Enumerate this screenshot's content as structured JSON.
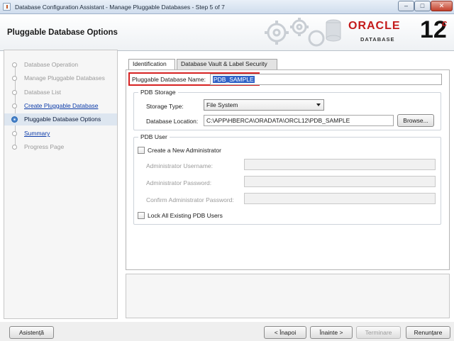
{
  "window": {
    "title": "Database Configuration Assistant - Manage Pluggable Databases - Step 5 of 7",
    "minimize_glyph": "‒",
    "maximize_glyph": "□",
    "close_glyph": "✕"
  },
  "header": {
    "page_title": "Pluggable Database Options",
    "logo_word": "ORACLE",
    "logo_sub": "DATABASE",
    "logo_version": "12",
    "logo_version_suffix": "c",
    "brand_color": "#c41a1a"
  },
  "steps": [
    {
      "label": "Database Operation",
      "state": "disabled"
    },
    {
      "label": "Manage Pluggable Databases",
      "state": "disabled"
    },
    {
      "label": "Database List",
      "state": "disabled"
    },
    {
      "label": "Create Pluggable Database",
      "state": "link"
    },
    {
      "label": "Pluggable Database Options",
      "state": "current"
    },
    {
      "label": "Summary",
      "state": "link"
    },
    {
      "label": "Progress Page",
      "state": "disabled"
    }
  ],
  "tabs": [
    {
      "label": "Identification",
      "active": true
    },
    {
      "label": "Database Vault & Label Security",
      "active": false
    }
  ],
  "identification": {
    "pdb_name_label": "Pluggable Database Name:",
    "pdb_name_value": "PDB_SAMPLE"
  },
  "pdb_storage": {
    "group_title": "PDB Storage",
    "storage_type_label": "Storage Type:",
    "storage_type_value": "File System",
    "location_label": "Database Location:",
    "location_value": "C:\\APP\\HBERCA\\ORADATA\\ORCL12\\PDB_SAMPLE",
    "browse_label": "Browse..."
  },
  "pdb_user": {
    "group_title": "PDB User",
    "create_admin_label": "Create a New Administrator",
    "create_admin_checked": false,
    "admin_username_label": "Administrator Username:",
    "admin_password_label": "Administrator Password:",
    "confirm_password_label": "Confirm Administrator Password:",
    "lock_users_label": "Lock All Existing PDB Users",
    "lock_users_checked": false
  },
  "footer": {
    "help_label": "Asistență",
    "back_label": "< Înapoi",
    "next_label": "Înainte >",
    "finish_label": "Terminare",
    "cancel_label": "Renunțare"
  }
}
